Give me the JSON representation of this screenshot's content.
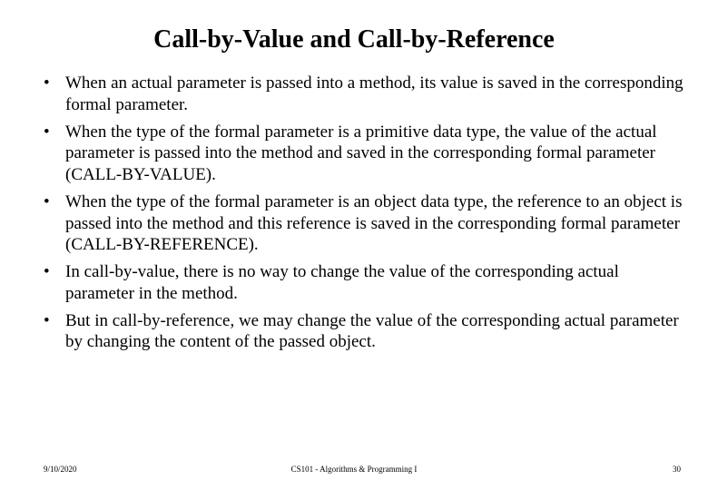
{
  "title": "Call-by-Value and Call-by-Reference",
  "bullets": [
    "When an actual parameter is passed into a method, its value is saved in  the corresponding formal parameter.",
    "When the type of the formal parameter is a primitive data type, the value of the actual parameter is passed into the method and saved in   the corresponding formal parameter (CALL-BY-VALUE).",
    "When the type of the formal parameter is an object data type, the reference to an object is passed into the method and this reference is saved in the corresponding formal parameter (CALL-BY-REFERENCE).",
    "In call-by-value, there is no way to change the value of the corresponding actual parameter in the method.",
    "But in call-by-reference, we may change the value of the corresponding actual parameter by changing the content of the passed object."
  ],
  "footer": {
    "date": "9/10/2020",
    "course": "CS101 - Algorithms & Programming I",
    "page": "30"
  }
}
